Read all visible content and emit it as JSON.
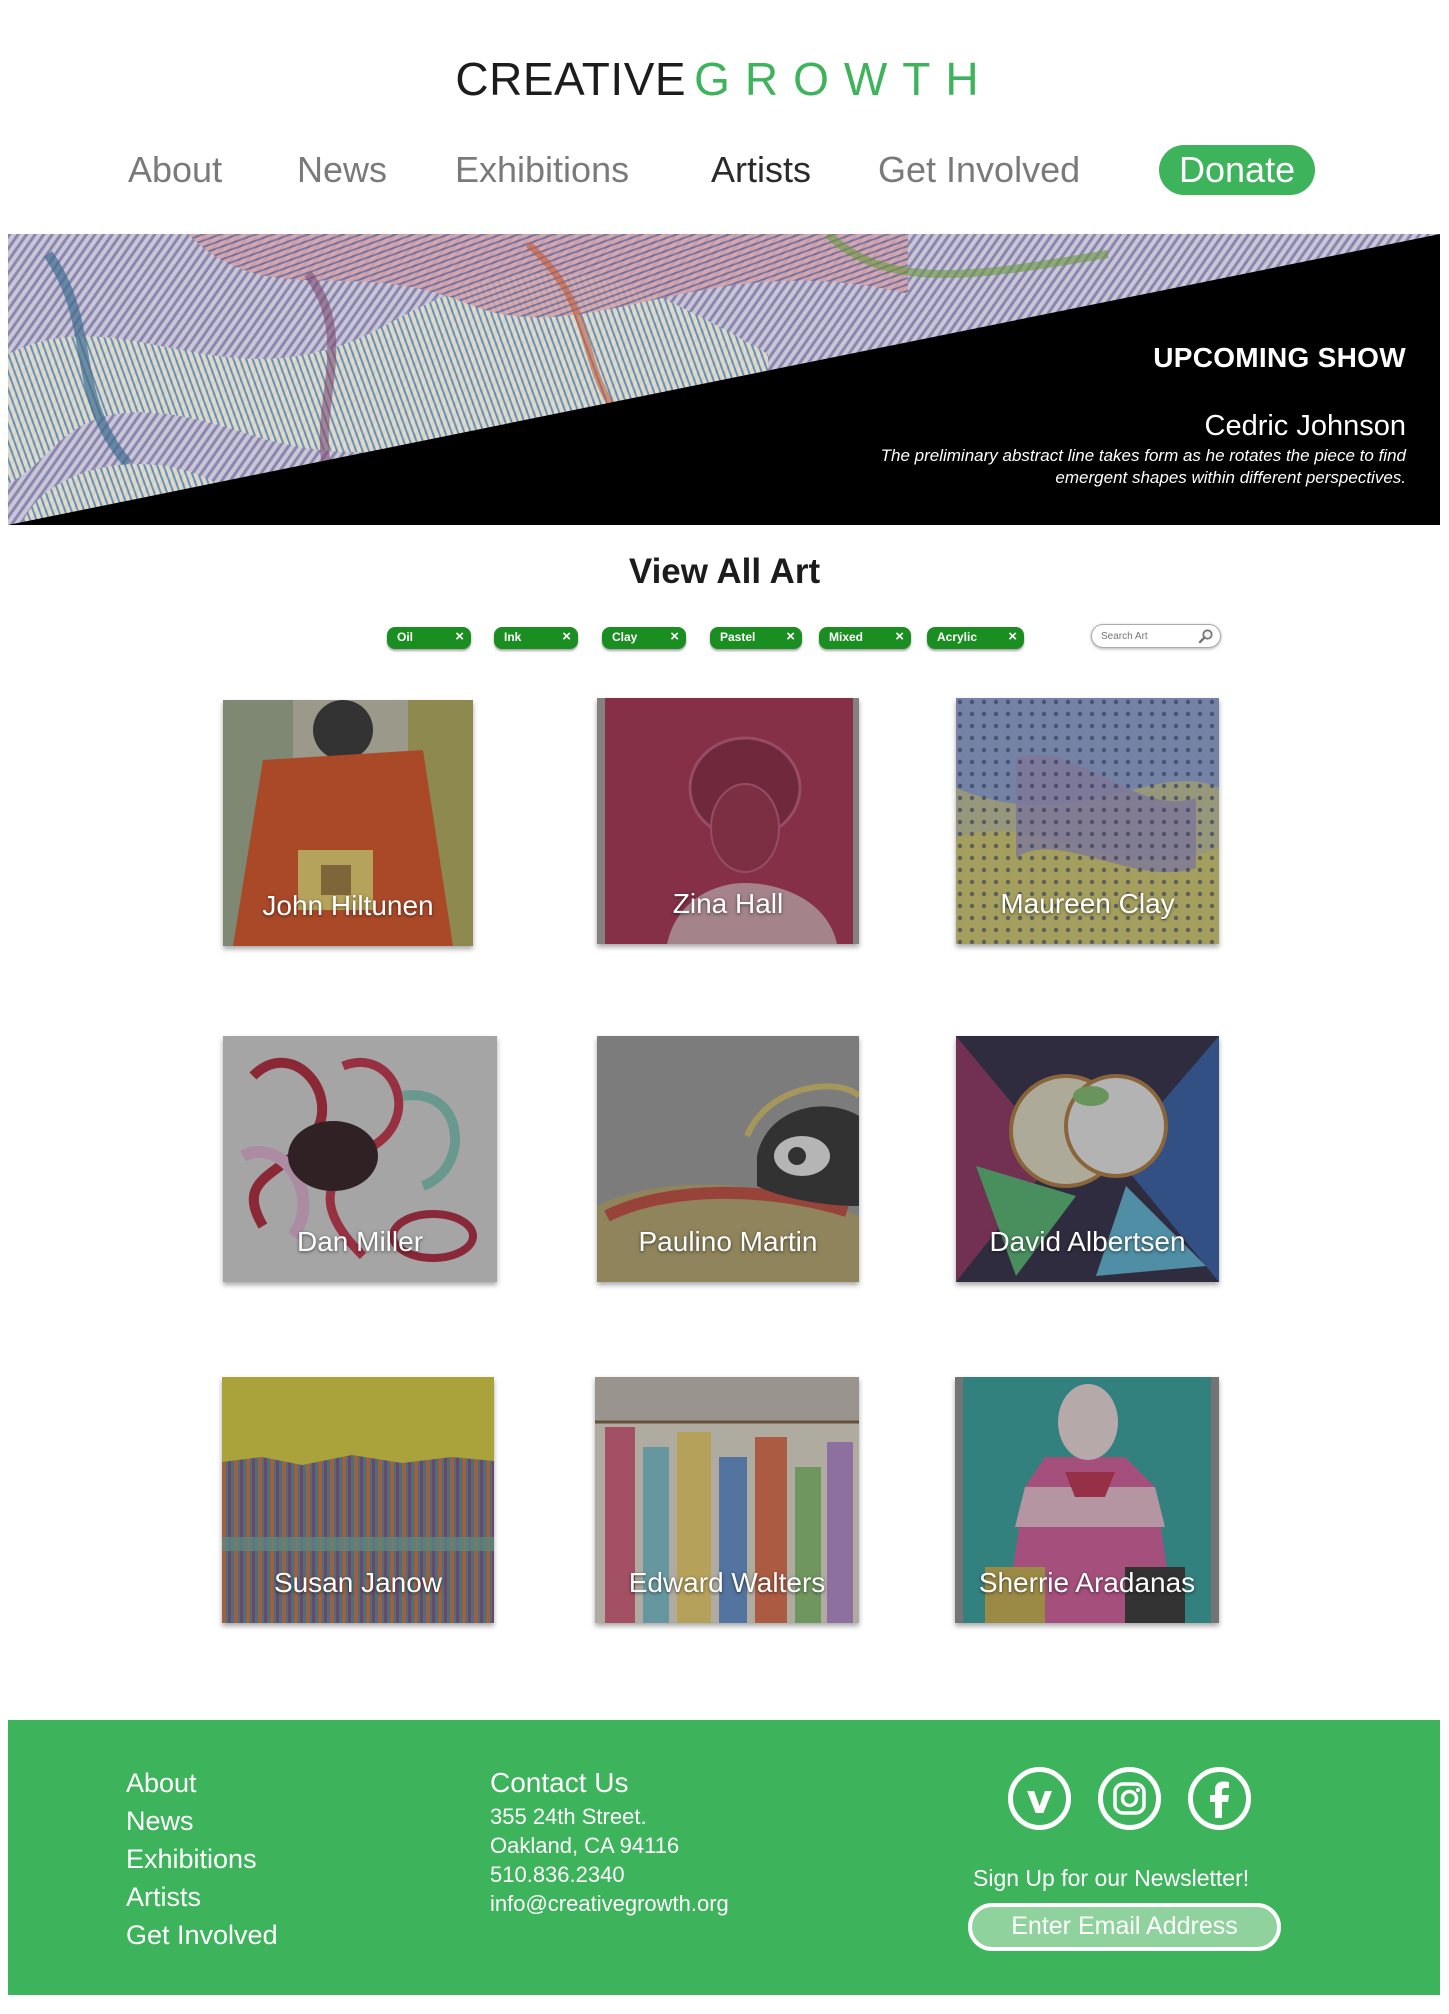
{
  "logo": {
    "word1": "CREATIVE",
    "word2": "GROWTH"
  },
  "nav": {
    "about": "About",
    "news": "News",
    "exhibitions": "Exhibitions",
    "artists": "Artists",
    "get_involved": "Get Involved",
    "donate": "Donate",
    "active": "Artists"
  },
  "hero": {
    "label": "UPCOMING SHOW",
    "artist": "Cedric Johnson",
    "description": "The preliminary abstract line takes form as he rotates the piece to find emergent shapes within different perspectives."
  },
  "gallery": {
    "title": "View All Art",
    "filters": [
      "Oil",
      "Ink",
      "Clay",
      "Pastel",
      "Mixed",
      "Acrylic"
    ],
    "filter_close_icon": "×",
    "search_placeholder": "Search Art",
    "artists": [
      "John Hiltunen",
      "Zina Hall",
      "Maureen Clay",
      "Dan Miller",
      "Paulino Martin",
      "David Albertsen",
      "Susan Janow",
      "Edward Walters",
      "Sherrie Aradanas"
    ]
  },
  "footer": {
    "links": [
      "About",
      "News",
      "Exhibitions",
      "Artists",
      "Get Involved"
    ],
    "contact_heading": "Contact Us",
    "address1": "355 24th Street.",
    "address2": "Oakland, CA 94116",
    "phone": "510.836.2340",
    "email": "info@creativegrowth.org",
    "social_icons": [
      "vimeo-icon",
      "instagram-icon",
      "facebook-icon"
    ],
    "newsletter": "Sign Up for our Newsletter!",
    "email_placeholder": "Enter Email Address"
  },
  "colors": {
    "brand_green": "#3db35b",
    "chip_green": "#1b8e22",
    "nav_gray": "#7a7a7a",
    "hero_black": "#000000"
  }
}
